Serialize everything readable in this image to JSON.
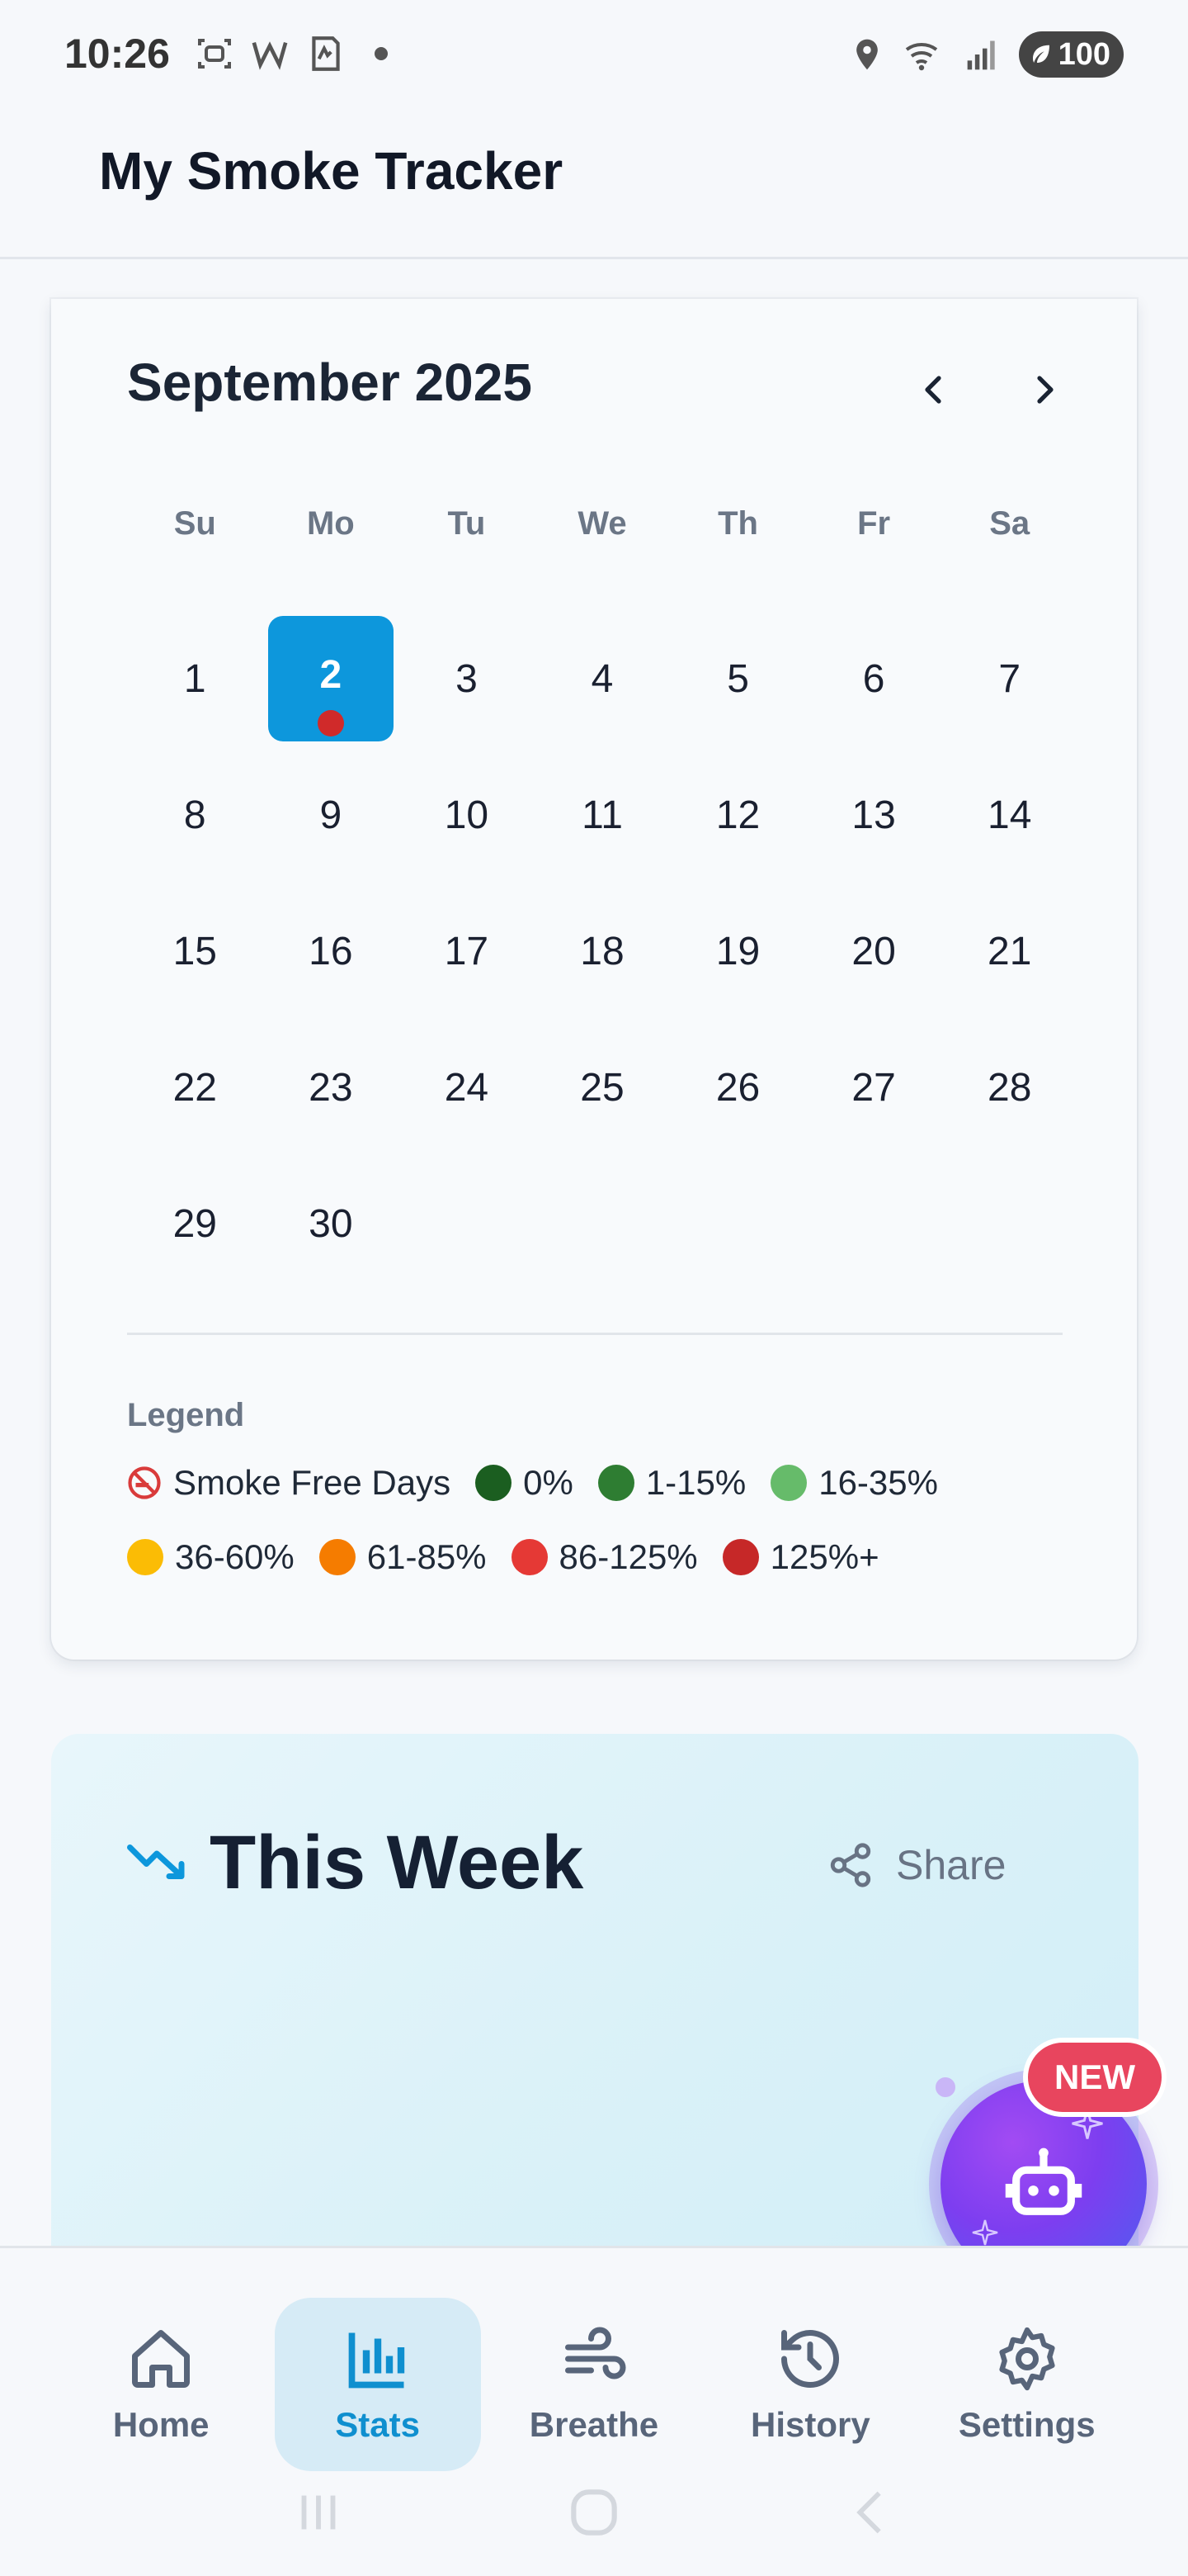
{
  "status_bar": {
    "time": "10:26",
    "battery": "100",
    "left_icons": [
      "screenshot-icon",
      "w-icon",
      "phone-app-icon",
      "dot-icon"
    ],
    "right_icons": [
      "location-icon",
      "wifi-icon",
      "signal-icon",
      "battery-icon"
    ]
  },
  "app_bar": {
    "title": "My Smoke Tracker"
  },
  "calendar": {
    "month_title": "September 2025",
    "weekdays": [
      "Su",
      "Mo",
      "Tu",
      "We",
      "Th",
      "Fr",
      "Sa"
    ],
    "days": [
      "1",
      "2",
      "3",
      "4",
      "5",
      "6",
      "7",
      "8",
      "9",
      "10",
      "11",
      "12",
      "13",
      "14",
      "15",
      "16",
      "17",
      "18",
      "19",
      "20",
      "21",
      "22",
      "23",
      "24",
      "25",
      "26",
      "27",
      "28",
      "29",
      "30"
    ],
    "selected_day": "2",
    "selected_day_marker_color": "#d02a2a",
    "accent_color": "#0d97dc"
  },
  "legend": {
    "title": "Legend",
    "items": [
      {
        "label": "Smoke Free Days",
        "icon": "no-smoking-icon"
      },
      {
        "label": "0%",
        "color": "#1b5e20"
      },
      {
        "label": "1-15%",
        "color": "#2e7d32"
      },
      {
        "label": "16-35%",
        "color": "#66bb6a"
      },
      {
        "label": "36-60%",
        "color": "#fbbc05"
      },
      {
        "label": "61-85%",
        "color": "#f57c00"
      },
      {
        "label": "86-125%",
        "color": "#e53935"
      },
      {
        "label": "125%+",
        "color": "#c62828"
      }
    ]
  },
  "week_card": {
    "title": "This Week",
    "share_label": "Share",
    "icon": "trending-down-icon"
  },
  "fab": {
    "badge": "NEW",
    "icon": "robot-icon"
  },
  "bottom_nav": {
    "items": [
      {
        "label": "Home",
        "icon": "home-icon",
        "active": false
      },
      {
        "label": "Stats",
        "icon": "bar-chart-icon",
        "active": true
      },
      {
        "label": "Breathe",
        "icon": "wind-icon",
        "active": false
      },
      {
        "label": "History",
        "icon": "history-icon",
        "active": false
      },
      {
        "label": "Settings",
        "icon": "gear-icon",
        "active": false
      }
    ]
  }
}
